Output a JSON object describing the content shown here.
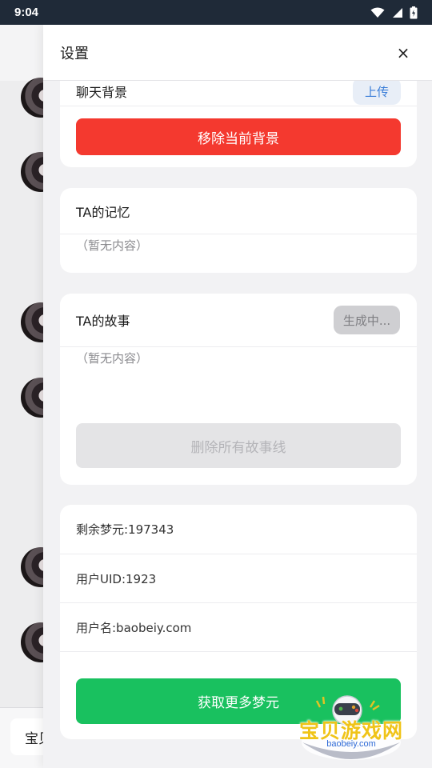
{
  "status_bar": {
    "time": "9:04"
  },
  "background": {
    "footer_input_text": "宝贝"
  },
  "drawer": {
    "title": "设置",
    "close_glyph": "×",
    "background_card": {
      "row_label": "聊天背景",
      "upload_label": "上传",
      "remove_button": "移除当前背景"
    },
    "memory_card": {
      "title": "TA的记忆",
      "empty_text": "（暂无内容）"
    },
    "story_card": {
      "title": "TA的故事",
      "generating_label": "生成中...",
      "empty_text": "（暂无内容）",
      "delete_button": "删除所有故事线"
    },
    "account_card": {
      "coins": "剩余梦元:197343",
      "uid": "用户UID:1923",
      "username": "用户名:baobeiy.com",
      "get_more_button": "获取更多梦元"
    }
  },
  "watermark": {
    "title": "宝贝游戏网",
    "url": "baobeiy.com"
  },
  "colors": {
    "danger": "#f4392f",
    "success": "#19c15f",
    "disabled_bg": "#e4e4e6",
    "disabled_text": "#b4b4b8",
    "status_bar": "#1f2a38"
  }
}
